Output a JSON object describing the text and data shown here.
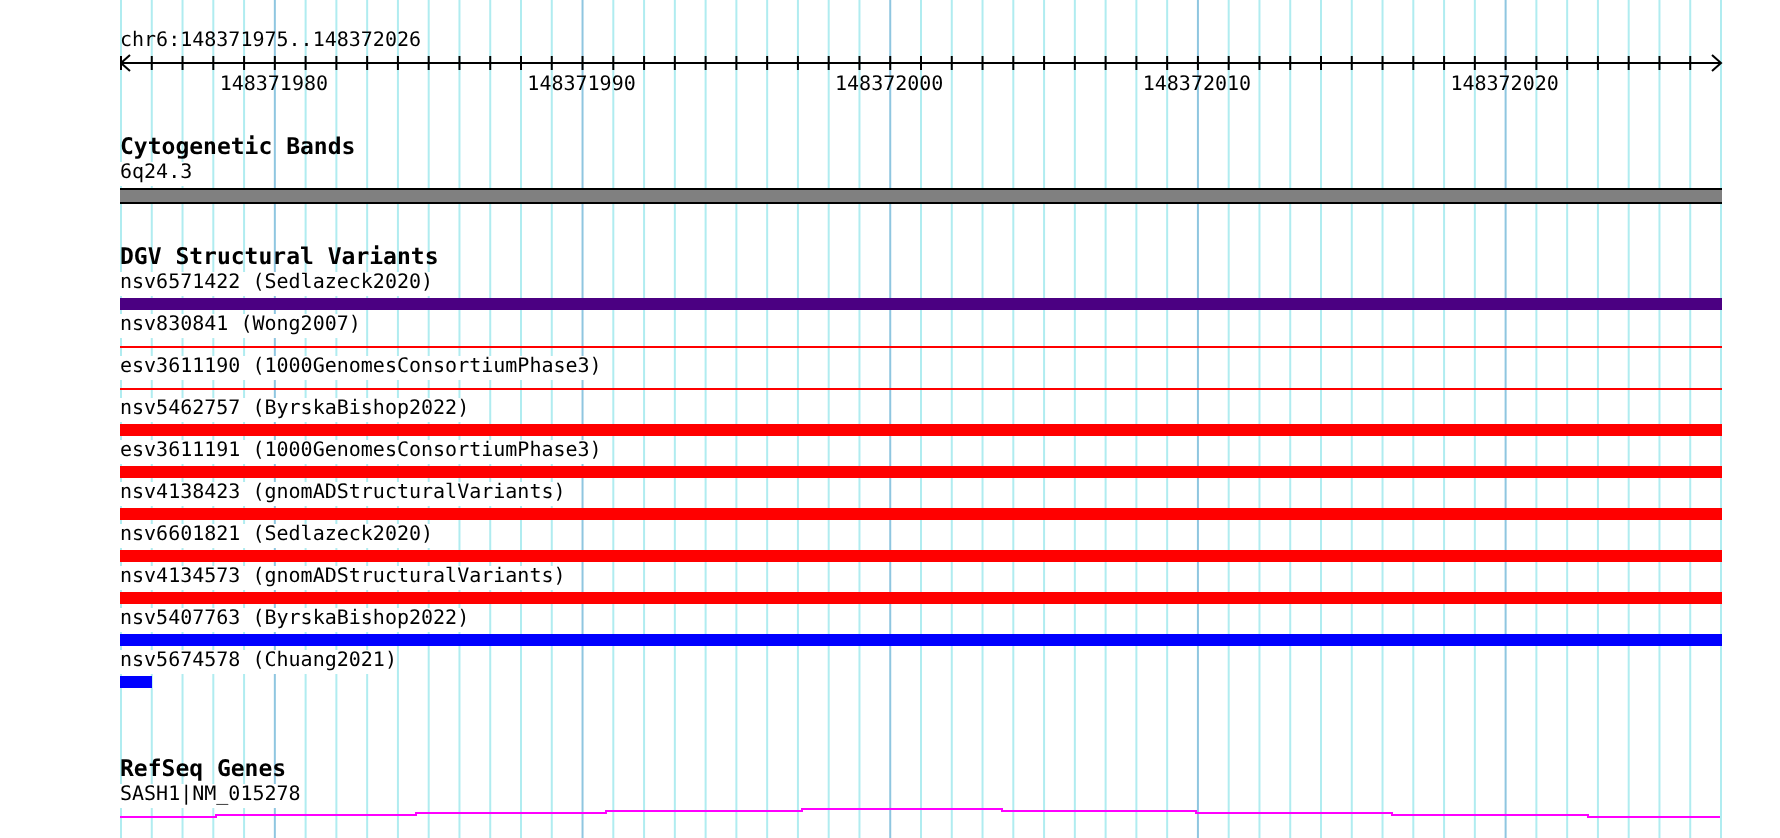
{
  "location": "chr6:148371975..148372026",
  "ruler": {
    "labels": [
      "148371980",
      "148371990",
      "148372000",
      "148372010",
      "148372020"
    ]
  },
  "tracks": [
    {
      "kind": "band",
      "title": "Cytogenetic Bands",
      "features": [
        {
          "label": "6q24.3",
          "kind": "thick",
          "color": "#808080"
        }
      ]
    },
    {
      "kind": "variants",
      "title": "DGV Structural Variants",
      "features": [
        {
          "label": "nsv6571422 (Sedlazeck2020)",
          "kind": "thick",
          "color": "#4b0082"
        },
        {
          "label": "nsv830841 (Wong2007)",
          "kind": "thin",
          "color": "#ff0000"
        },
        {
          "label": "esv3611190 (1000GenomesConsortiumPhase3)",
          "kind": "thin",
          "color": "#ff0000"
        },
        {
          "label": "nsv5462757 (ByrskaBishop2022)",
          "kind": "thick",
          "color": "#ff0000"
        },
        {
          "label": "esv3611191 (1000GenomesConsortiumPhase3)",
          "kind": "thick",
          "color": "#ff0000"
        },
        {
          "label": "nsv4138423 (gnomADStructuralVariants)",
          "kind": "thick",
          "color": "#ff0000"
        },
        {
          "label": "nsv6601821 (Sedlazeck2020)",
          "kind": "thick",
          "color": "#ff0000"
        },
        {
          "label": "nsv4134573 (gnomADStructuralVariants)",
          "kind": "thick",
          "color": "#ff0000"
        },
        {
          "label": "nsv5407763 (ByrskaBishop2022)",
          "kind": "thick",
          "color": "#0000ff"
        },
        {
          "label": "nsv5674578 (Chuang2021)",
          "kind": "stub",
          "color": "#0000ff"
        }
      ]
    },
    {
      "kind": "genes",
      "title": "RefSeq Genes",
      "features": [
        {
          "label": "SASH1|NM_015278",
          "kind": "gene",
          "color": "#ff00ff"
        }
      ]
    }
  ]
}
